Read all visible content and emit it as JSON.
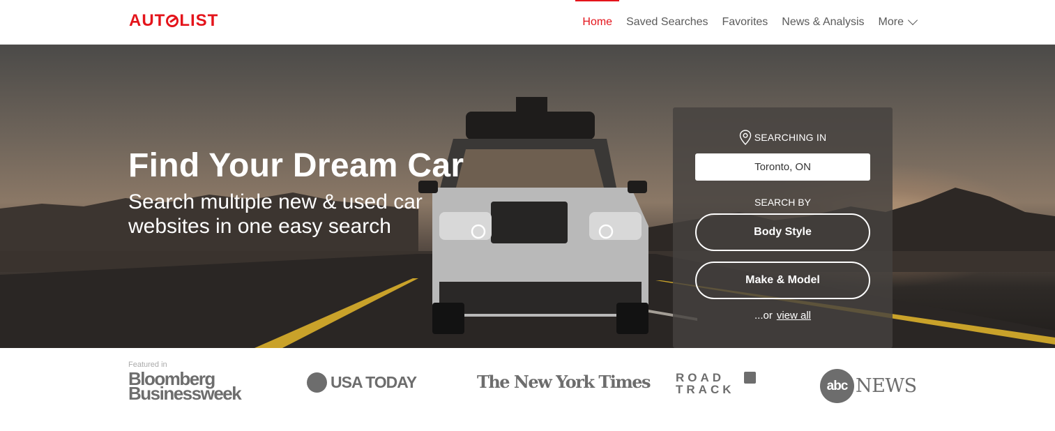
{
  "header": {
    "logo": "AUTOLIST",
    "nav": [
      {
        "label": "Home",
        "active": true
      },
      {
        "label": "Saved Searches",
        "active": false
      },
      {
        "label": "Favorites",
        "active": false
      },
      {
        "label": "News & Analysis",
        "active": false
      },
      {
        "label": "More",
        "active": false
      }
    ]
  },
  "hero": {
    "title": "Find Your Dream Car",
    "subtitle": "Search multiple new & used car websites in one easy search"
  },
  "search_panel": {
    "searching_in_label": "SEARCHING IN",
    "location_value": "Toronto, ON",
    "search_by_label": "SEARCH BY",
    "body_style_label": "Body Style",
    "make_model_label": "Make & Model",
    "or_text": "...or",
    "view_all_label": "view all"
  },
  "featured": {
    "label": "Featured in",
    "logos": {
      "bloomberg_line1": "Bloomberg",
      "bloomberg_line2": "Businessweek",
      "usa_today": "USA TODAY",
      "nyt": "The New York Times",
      "roadtrack_line1": "ROAD",
      "roadtrack_line2": "TRACK",
      "abc": "abc",
      "abc_news": "NEWS"
    }
  },
  "colors": {
    "brand_red": "#e4141b",
    "nav_text": "#5a5a5a",
    "logo_gray": "#6d6d6d"
  },
  "icons": {
    "location": "map-pin-icon",
    "more_dropdown": "chevron-down-icon"
  }
}
